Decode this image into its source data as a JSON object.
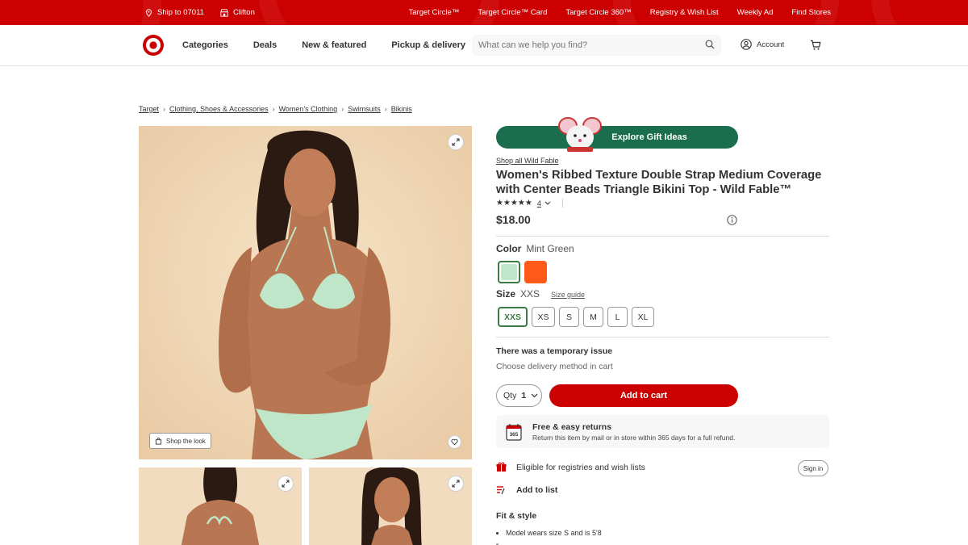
{
  "utility": {
    "ship_to": "Ship to 07011",
    "store": "Clifton",
    "links": [
      "Target Circle™",
      "Target Circle™ Card",
      "Target Circle 360™",
      "Registry & Wish List",
      "Weekly Ad",
      "Find Stores"
    ]
  },
  "header": {
    "nav": [
      "Categories",
      "Deals",
      "New & featured",
      "Pickup & delivery"
    ],
    "search_placeholder": "What can we help you find?",
    "account": "Account"
  },
  "breadcrumb": [
    "Target",
    "Clothing, Shoes & Accessories",
    "Women's Clothing",
    "Swimsuits",
    "Bikinis"
  ],
  "gallery": {
    "shop_the_look": "Shop the look"
  },
  "product": {
    "gift_banner": "Explore Gift Ideas",
    "brand_link": "Shop all Wild Fable",
    "title": "Women's Ribbed Texture Double Strap Medium Coverage with Center Beads Triangle Bikini Top - Wild Fable™",
    "stars": "★★★★★",
    "rating_value": 5,
    "rating_count": "4",
    "price": "$18.00",
    "color_label": "Color",
    "color_value": "Mint Green",
    "swatches": [
      {
        "name": "Mint Green",
        "color": "#bfe6c9",
        "selected": true
      },
      {
        "name": "Orange",
        "color": "#ff5a1a",
        "selected": false
      }
    ],
    "size_label": "Size",
    "size_value": "XXS",
    "size_guide": "Size guide",
    "sizes": [
      "XXS",
      "XS",
      "S",
      "M",
      "L",
      "XL"
    ],
    "selected_size": "XXS",
    "issue_title": "There was a temporary issue",
    "issue_sub": "Choose delivery method in cart",
    "qty_label": "Qty",
    "qty_value": "1",
    "add_to_cart": "Add to cart",
    "returns_title": "Free & easy returns",
    "returns_sub": "Return this item by mail or in store within 365 days for a full refund.",
    "returns_badge": "365",
    "registry": "Eligible for registries and wish lists",
    "sign_in": "Sign in",
    "add_to_list": "Add to list",
    "fit_title": "Fit & style",
    "fit_items": [
      "Model wears size S and is 5'8",
      ""
    ]
  },
  "colors": {
    "brand_red": "#cc0000",
    "banner_green": "#1b6e4d",
    "selected_green": "#3a7d44"
  }
}
